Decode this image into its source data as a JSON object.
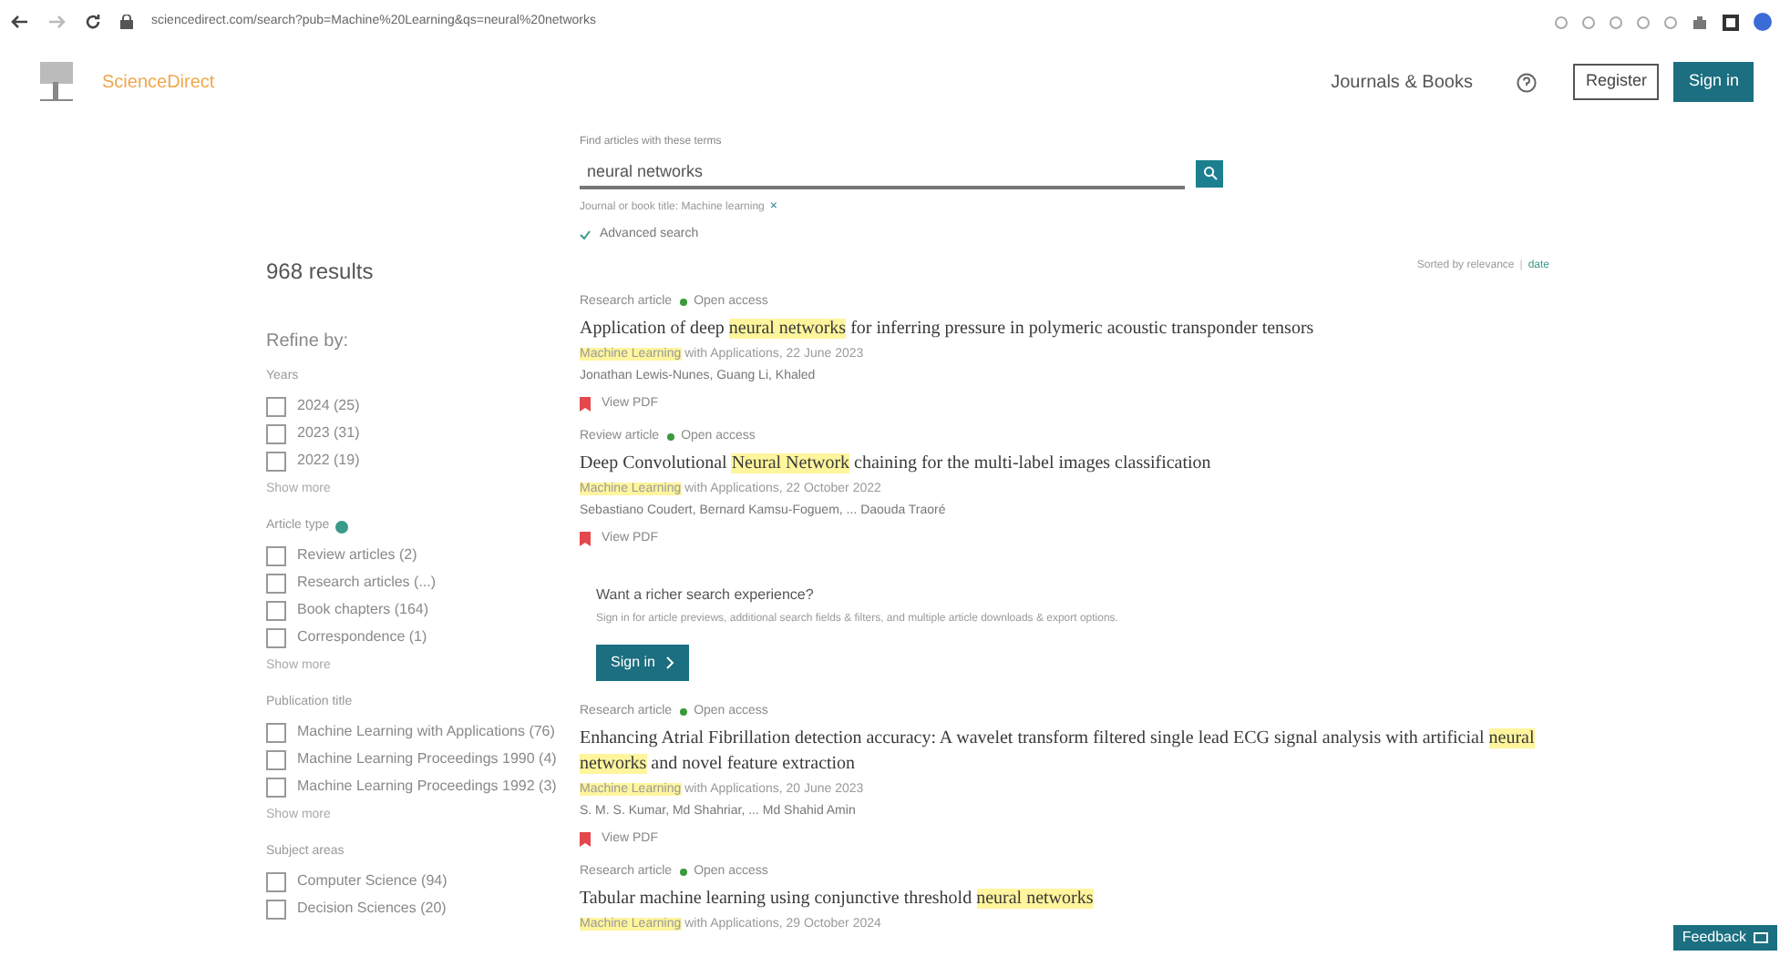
{
  "browser": {
    "url": "sciencedirect.com/search?pub=Machine%20Learning&qs=neural%20networks"
  },
  "header": {
    "brand": "ScienceDirect",
    "nav_link": "Journals & Books",
    "register": "Register",
    "sign_in": "Sign in"
  },
  "search": {
    "label": "Find articles with these terms",
    "value": "neural networks",
    "jump_text": "Journal or book title: Machine learning",
    "remove": "×",
    "advanced": "Advanced search"
  },
  "results_count": "968 results",
  "sort": {
    "label": "Sorted by relevance",
    "separator": "|",
    "alternative": "date"
  },
  "refine": {
    "title": "Refine by:",
    "groups": [
      {
        "title": "Years",
        "help": false,
        "items": [
          {
            "label": "2024 (25)",
            "checked": false
          },
          {
            "label": "2023 (31)",
            "checked": false
          },
          {
            "label": "2022 (19)",
            "checked": false
          }
        ],
        "more": "Show more"
      },
      {
        "title": "Article type",
        "help": true,
        "items": [
          {
            "label": "Review articles (2)",
            "checked": false
          },
          {
            "label": "Research articles (...)",
            "checked": false
          },
          {
            "label": "Book chapters (164)",
            "checked": false
          },
          {
            "label": "Correspondence (1)",
            "checked": false
          }
        ],
        "more": "Show more"
      },
      {
        "title": "Publication title",
        "help": false,
        "items": [
          {
            "label": "Machine Learning with Applications (76)",
            "checked": false
          },
          {
            "label": "Machine Learning Proceedings 1990 (4)",
            "checked": false
          },
          {
            "label": "Machine Learning Proceedings 1992 (3)",
            "checked": false
          }
        ],
        "more": "Show more"
      },
      {
        "title": "Subject areas",
        "help": false,
        "items": [
          {
            "label": "Computer Science (94)",
            "checked": false
          },
          {
            "label": "Decision Sciences (20)",
            "checked": false
          }
        ]
      }
    ]
  },
  "results": [
    {
      "kind": "article",
      "type": "Research article",
      "access": "Open access",
      "title": [
        {
          "text": "Application of deep ",
          "highlight": false
        },
        {
          "text": "neural networks",
          "highlight": true
        },
        {
          "text": " for inferring pressure in polymeric acoustic transponder tensors",
          "highlight": false
        }
      ],
      "journal": [
        {
          "text": "Machine Learning",
          "highlight": true
        },
        {
          "text": " with Applications, 22 June 2023",
          "highlight": false
        }
      ],
      "authors": "Jonathan Lewis-Nunes, Guang Li, Khaled",
      "pdf": "View PDF"
    },
    {
      "kind": "article",
      "type": "Review article",
      "access": "Open access",
      "title": [
        {
          "text": "Deep Convolutional ",
          "highlight": false
        },
        {
          "text": "Neural Network",
          "highlight": true
        },
        {
          "text": " chaining for the multi-label images classification",
          "highlight": false
        }
      ],
      "journal": [
        {
          "text": "Machine Learning",
          "highlight": true
        },
        {
          "text": " with Applications, 22 October 2022",
          "highlight": false
        }
      ],
      "authors": "Sebastiano Coudert, Bernard Kamsu-Foguem, ... Daouda Traoré",
      "pdf": "View PDF"
    },
    {
      "kind": "promo",
      "heading": "Want a richer search experience?",
      "text": "Sign in for article previews, additional search fields & filters, and multiple article downloads & export options.",
      "button": "Sign in"
    },
    {
      "kind": "article",
      "type": "Research article",
      "access": "Open access",
      "title": [
        {
          "text": "Enhancing Atrial Fibrillation detection accuracy: A wavelet transform filtered single lead ECG signal analysis with artificial ",
          "highlight": false
        },
        {
          "text": "neural networks",
          "highlight": true
        },
        {
          "text": " and novel feature extraction",
          "highlight": false
        }
      ],
      "journal": [
        {
          "text": "Machine Learning",
          "highlight": true
        },
        {
          "text": " with Applications, 20 June 2023",
          "highlight": false
        }
      ],
      "authors": "S. M. S. Kumar, Md Shahriar, ... Md Shahid Amin",
      "pdf": "View PDF"
    },
    {
      "kind": "article",
      "type": "Research article",
      "access": "Open access",
      "title": [
        {
          "text": "Tabular machine learning using conjunctive threshold ",
          "highlight": false
        },
        {
          "text": "neural networks",
          "highlight": true
        }
      ],
      "journal": [
        {
          "text": "Machine Learning",
          "highlight": true
        },
        {
          "text": " with Applications, 29 October 2024",
          "highlight": false
        }
      ]
    }
  ],
  "feedback": "Feedback"
}
